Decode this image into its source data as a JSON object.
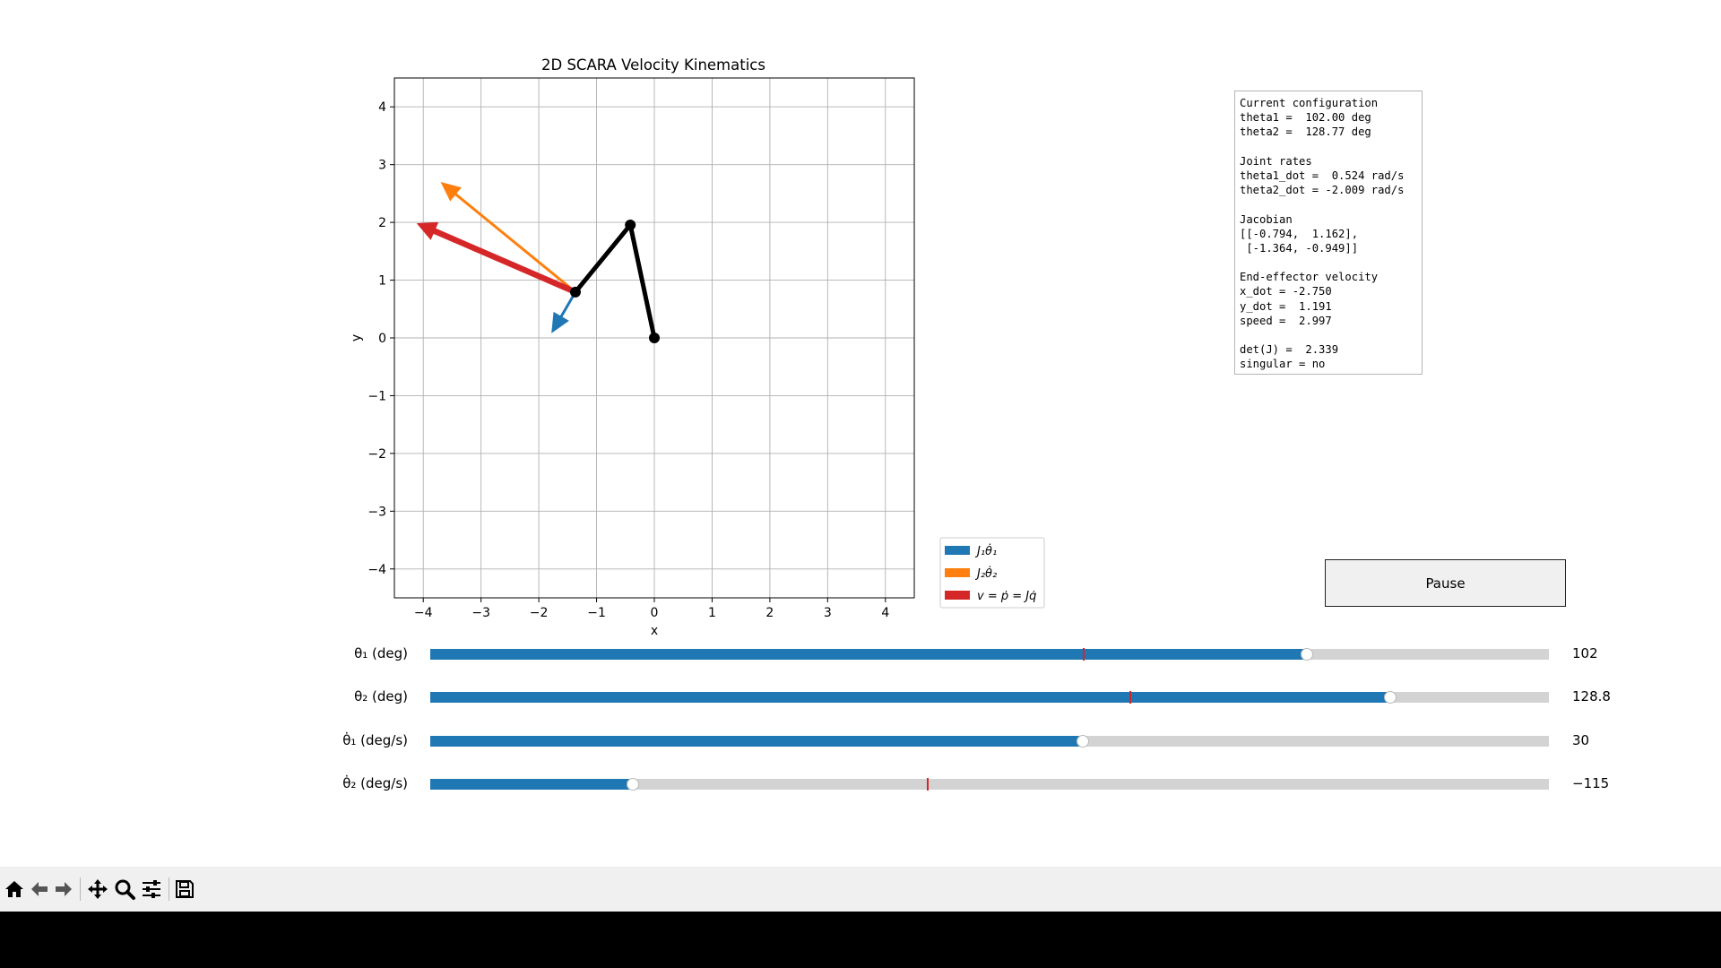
{
  "plot": {
    "title": "2D SCARA Velocity Kinematics",
    "xlabel": "x",
    "ylabel": "y",
    "xticks": [
      {
        "v": -4,
        "label": "−4"
      },
      {
        "v": -3,
        "label": "−3"
      },
      {
        "v": -2,
        "label": "−2"
      },
      {
        "v": -1,
        "label": "−1"
      },
      {
        "v": 0,
        "label": "0"
      },
      {
        "v": 1,
        "label": "1"
      },
      {
        "v": 2,
        "label": "2"
      },
      {
        "v": 3,
        "label": "3"
      },
      {
        "v": 4,
        "label": "4"
      }
    ],
    "yticks": [
      {
        "v": 4,
        "label": "4"
      },
      {
        "v": 3,
        "label": "3"
      },
      {
        "v": 2,
        "label": "2"
      },
      {
        "v": 1,
        "label": "1"
      },
      {
        "v": 0,
        "label": "0"
      },
      {
        "v": -1,
        "label": "−1"
      },
      {
        "v": -2,
        "label": "−2"
      },
      {
        "v": -3,
        "label": "−3"
      },
      {
        "v": -4,
        "label": "−4"
      }
    ],
    "xlim": [
      -4.5,
      4.5
    ],
    "ylim": [
      -4.5,
      4.5
    ],
    "grid": true,
    "arm_points": [
      [
        0,
        0
      ],
      [
        -0.416,
        1.956
      ],
      [
        -1.366,
        0.794
      ]
    ],
    "arrows": [
      {
        "name": "J1-arrow",
        "color": "#1f77b4",
        "start": [
          -1.366,
          0.794
        ],
        "vector": [
          -0.416,
          -0.715
        ]
      },
      {
        "name": "J2-arrow",
        "color": "#ff7f0e",
        "start": [
          -1.366,
          0.794
        ],
        "vector": [
          -2.334,
          1.906
        ]
      },
      {
        "name": "v-arrow",
        "color": "#d62728",
        "start": [
          -1.366,
          0.794
        ],
        "vector": [
          -2.75,
          1.191
        ]
      }
    ],
    "legend": [
      {
        "label": "J₁θ̇₁",
        "color": "#1f77b4"
      },
      {
        "label": "J₂θ̇₂",
        "color": "#ff7f0e"
      },
      {
        "label": "v = ṗ = Jq̇",
        "color": "#d62728"
      }
    ],
    "legend_placement": "outside-lower-right"
  },
  "info": {
    "lines": [
      "Current configuration",
      "theta1 =  102.00 deg",
      "theta2 =  128.77 deg",
      "",
      "Joint rates",
      "theta1_dot =  0.524 rad/s",
      "theta2_dot = -2.009 rad/s",
      "",
      "Jacobian",
      "[[-0.794,  1.162],",
      " [-1.364, -0.949]]",
      "",
      "End-effector velocity",
      "x_dot = -2.750",
      "y_dot =  1.191",
      "speed =  2.997",
      "",
      "det(J) =  2.339",
      "singular = no"
    ]
  },
  "pause_label": "Pause",
  "sliders": [
    {
      "name": "theta1",
      "label": "θ₁ (deg)",
      "value_text": "102",
      "fraction": 0.784,
      "initial_fraction": 0.583
    },
    {
      "name": "theta2",
      "label": "θ₂ (deg)",
      "value_text": "128.8",
      "fraction": 0.858,
      "initial_fraction": 0.625
    },
    {
      "name": "theta1-dot",
      "label": "θ̇₁ (deg/s)",
      "value_text": "30",
      "fraction": 0.583,
      "initial_fraction": 0.583
    },
    {
      "name": "theta2-dot",
      "label": "θ̇₂ (deg/s)",
      "value_text": "−115",
      "fraction": 0.181,
      "initial_fraction": 0.444
    }
  ],
  "chart_data": {
    "type": "scatter",
    "title": "2D SCARA Velocity Kinematics",
    "xlabel": "x",
    "ylabel": "y",
    "xlim": [
      -4.5,
      4.5
    ],
    "ylim": [
      -4.5,
      4.5
    ],
    "grid": true,
    "series": [
      {
        "name": "J₁θ̇₁",
        "x": [
          -1.366,
          -1.782
        ],
        "y": [
          0.794,
          0.079
        ]
      },
      {
        "name": "J₂θ̇₂",
        "x": [
          -1.366,
          -3.7
        ],
        "y": [
          0.794,
          2.7
        ]
      },
      {
        "name": "v = ṗ = Jq̇",
        "x": [
          -1.366,
          -4.116
        ],
        "y": [
          0.794,
          1.985
        ]
      }
    ],
    "arm": {
      "x": [
        0,
        -0.416,
        -1.366
      ],
      "y": [
        0,
        1.956,
        0.794
      ]
    }
  },
  "toolbar": {
    "icons": [
      "home-icon",
      "back-arrow-icon",
      "forward-arrow-icon",
      "pan-icon",
      "zoom-icon",
      "configure-subplots-icon",
      "save-icon"
    ]
  }
}
